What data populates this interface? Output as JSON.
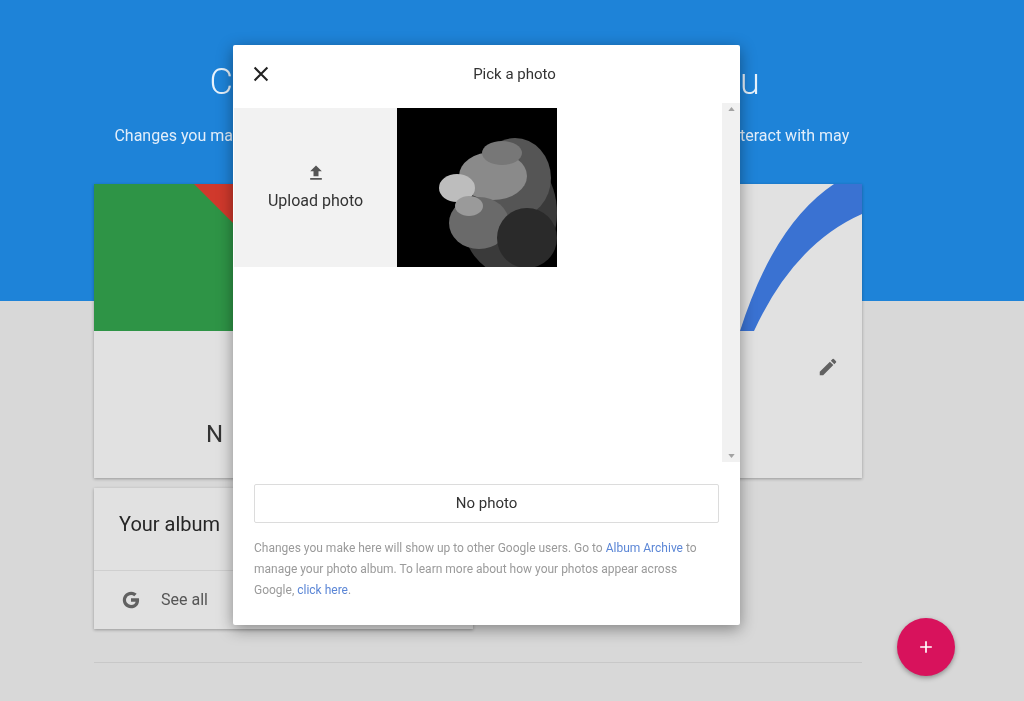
{
  "page": {
    "heading_left": "C",
    "heading_right": "u",
    "subtitle_left": "Changes you ma",
    "subtitle_right": "teract with may"
  },
  "profile_card": {
    "name_fragment": "N"
  },
  "album_card": {
    "title": "Your album",
    "link": "See all"
  },
  "dialog": {
    "title": "Pick a photo",
    "upload_label": "Upload photo",
    "no_photo_button": "No photo",
    "footer": [
      {
        "kind": "text",
        "text": "Changes you make here will show up to other Google users. Go to "
      },
      {
        "kind": "link",
        "text": "Album Archive"
      },
      {
        "kind": "text",
        "text": " to manage your photo album. To learn more about how your photos appear across Google, "
      },
      {
        "kind": "link",
        "text": "click here"
      },
      {
        "kind": "text",
        "text": "."
      }
    ]
  }
}
